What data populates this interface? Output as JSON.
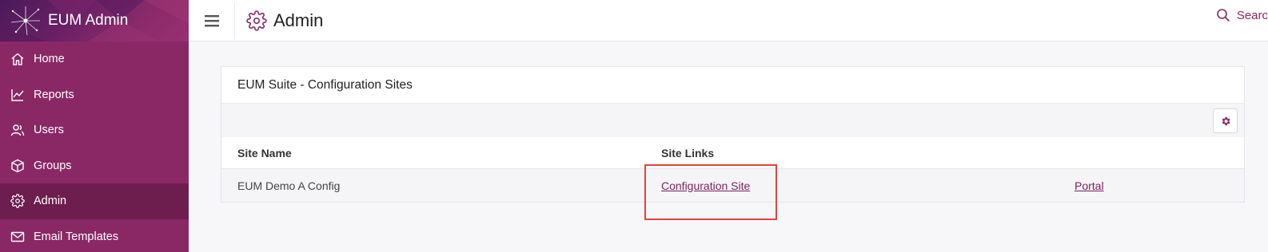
{
  "sidebar": {
    "brand_title": "EUM Admin",
    "items": [
      {
        "label": "Home",
        "icon": "home-icon"
      },
      {
        "label": "Reports",
        "icon": "chart-line-icon"
      },
      {
        "label": "Users",
        "icon": "users-icon"
      },
      {
        "label": "Groups",
        "icon": "cube-icon"
      },
      {
        "label": "Admin",
        "icon": "gear-icon",
        "active": true
      },
      {
        "label": "Email Templates",
        "icon": "envelope-icon"
      }
    ]
  },
  "header": {
    "title": "Admin",
    "search_label": "Searc"
  },
  "card": {
    "title": "EUM Suite - Configuration Sites",
    "columns": [
      "Site Name",
      "Site Links"
    ],
    "rows": [
      {
        "site_name": "EUM Demo A Config",
        "config_link": "Configuration Site",
        "portal_link": "Portal"
      }
    ]
  },
  "colors": {
    "sidebar": "#8a2866",
    "sidebar_active": "#6e1d4f",
    "accent": "#7a1f5c",
    "highlight": "#e0443c"
  }
}
